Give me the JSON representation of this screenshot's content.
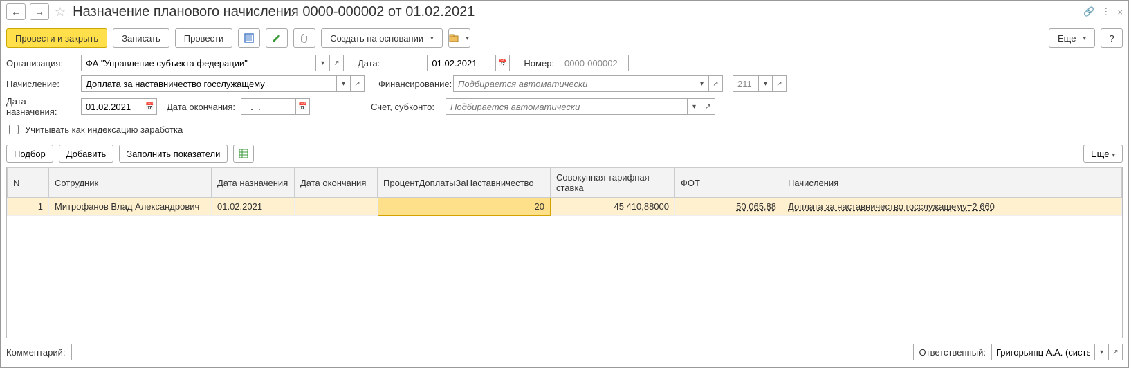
{
  "title": "Назначение планового начисления 0000-000002 от 01.02.2021",
  "nav": {
    "back": "←",
    "forward": "→"
  },
  "toolbar": {
    "post_close": "Провести и закрыть",
    "save": "Записать",
    "post": "Провести",
    "create_based": "Создать на основании",
    "more": "Еще",
    "help": "?"
  },
  "form": {
    "org_label": "Организация:",
    "org_value": "ФА \"Управление субъекта федерации\"",
    "date_label": "Дата:",
    "date_value": "01.02.2021",
    "number_label": "Номер:",
    "number_value": "0000-000002",
    "accrual_label": "Начисление:",
    "accrual_value": "Доплата за наставничество госслужащему",
    "financing_label": "Финансирование:",
    "financing_placeholder": "Подбирается автоматически",
    "kbk_value": "211",
    "assign_date_label": "Дата назначения:",
    "assign_date_value": "01.02.2021",
    "end_date_label": "Дата окончания:",
    "end_date_value": "  .  .    ",
    "account_label": "Счет, субконто:",
    "account_placeholder": "Подбирается автоматически",
    "indexation_checkbox": "Учитывать как индексацию заработка"
  },
  "subtoolbar": {
    "pick": "Подбор",
    "add": "Добавить",
    "fill": "Заполнить показатели",
    "more": "Еще"
  },
  "table": {
    "headers": {
      "n": "N",
      "employee": "Сотрудник",
      "assign_date": "Дата назначения",
      "end_date": "Дата окончания",
      "percent": "ПроцентДоплатыЗаНаставничество",
      "tariff": "Совокупная тарифная ставка",
      "fot": "ФОТ",
      "accruals": "Начисления"
    },
    "rows": [
      {
        "n": "1",
        "employee": "Митрофанов Влад Александрович",
        "assign_date": "01.02.2021",
        "end_date": "",
        "percent": "20",
        "tariff": "45 410,88000",
        "fot": "50 065,88",
        "accruals": "Доплата за наставничество госслужащему=2 660"
      }
    ]
  },
  "footer": {
    "comment_label": "Комментарий:",
    "responsible_label": "Ответственный:",
    "responsible_value": "Григорьянц А.А. (системн"
  }
}
